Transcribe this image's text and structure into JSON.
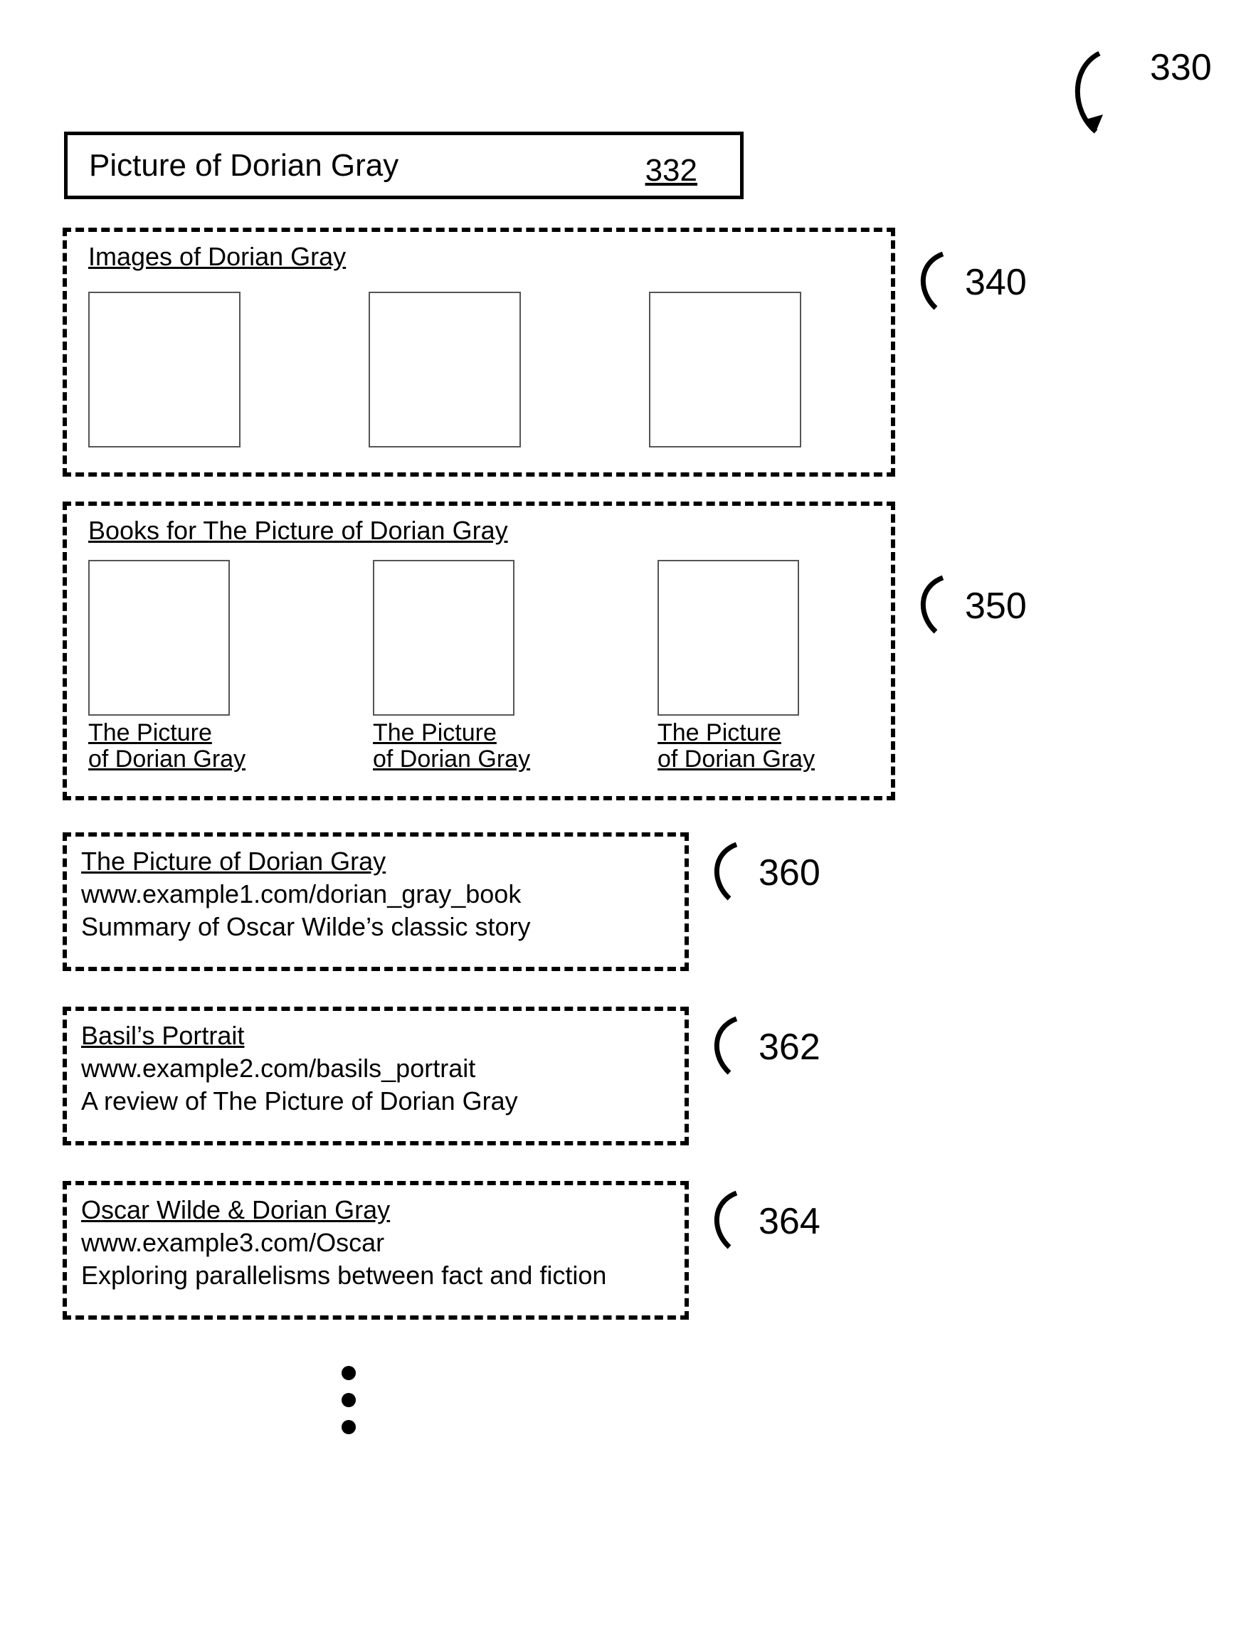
{
  "figure_ref": "330",
  "search": {
    "query": "Picture of Dorian Gray",
    "ref": "332"
  },
  "sections": {
    "images": {
      "title": "Images of Dorian Gray",
      "ref": "340"
    },
    "books": {
      "title": "Books for The Picture of Dorian Gray",
      "ref": "350",
      "items": [
        {
          "caption_l1": "The Picture",
          "caption_l2": "of Dorian Gray"
        },
        {
          "caption_l1": "The Picture",
          "caption_l2": "of Dorian Gray"
        },
        {
          "caption_l1": "The Picture",
          "caption_l2": "of Dorian Gray"
        }
      ]
    },
    "results": [
      {
        "ref": "360",
        "title": "The Picture of Dorian Gray",
        "url": "www.example1.com/dorian_gray_book",
        "snippet": "Summary of Oscar Wilde’s classic story"
      },
      {
        "ref": "362",
        "title": "Basil’s Portrait",
        "url": "www.example2.com/basils_portrait",
        "snippet": "A review of The Picture of Dorian Gray"
      },
      {
        "ref": "364",
        "title": "Oscar Wilde & Dorian Gray",
        "url": "www.example3.com/Oscar",
        "snippet": "Exploring parallelisms between fact and fiction"
      }
    ]
  }
}
